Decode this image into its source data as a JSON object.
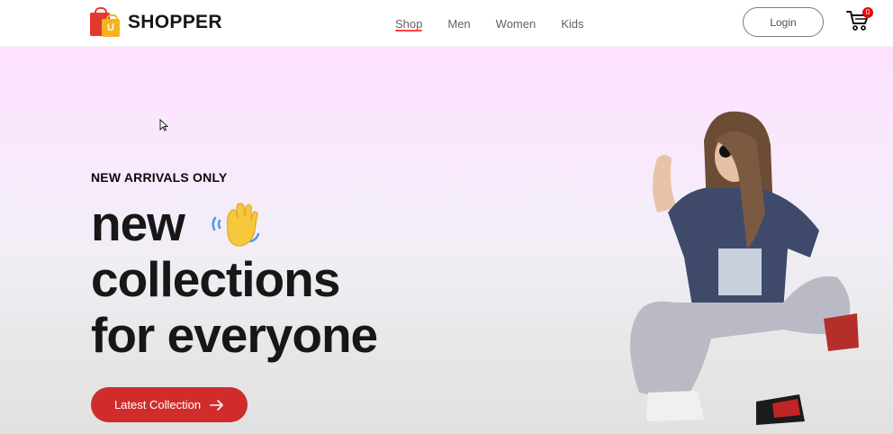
{
  "brand": {
    "name": "SHOPPER",
    "logo_letter": "U"
  },
  "nav": {
    "items": [
      {
        "label": "Shop",
        "active": true
      },
      {
        "label": "Men",
        "active": false
      },
      {
        "label": "Women",
        "active": false
      },
      {
        "label": "Kids",
        "active": false
      }
    ]
  },
  "header": {
    "login_label": "Login",
    "cart_count": "0"
  },
  "hero": {
    "eyebrow": "NEW ARRIVALS ONLY",
    "headline_line1": "new",
    "headline_line2": "collections",
    "headline_line3": "for everyone",
    "cta_label": "Latest Collection",
    "image_icon": "hero-model-image"
  },
  "colors": {
    "accent": "#d12c2c",
    "nav_underline": "#ff4141",
    "hero_gradient_top": "#fde1ff",
    "hero_gradient_bottom": "#e1e1e1",
    "cart_badge": "#e30b0b"
  },
  "icons": [
    "shopping-bag-logo-icon",
    "cart-icon",
    "waving-hand-icon",
    "arrow-right-icon",
    "mouse-cursor-icon"
  ]
}
